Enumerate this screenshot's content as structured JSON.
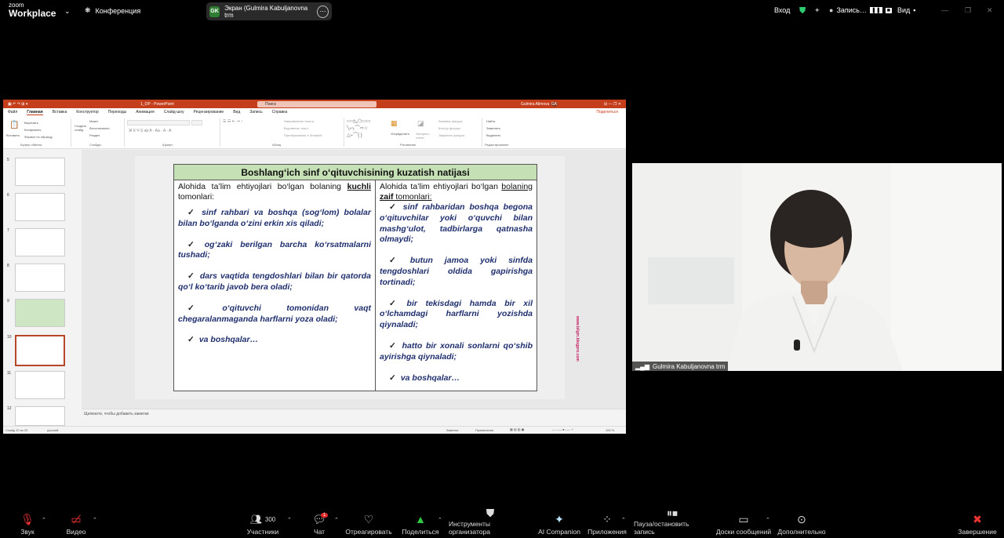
{
  "zoom": {
    "brand_top": "zoom",
    "brand_bottom": "Workplace",
    "conference": "Конференция",
    "share_label": "Экран (Gulmira Kabuljanovna trm",
    "share_initials": "GK",
    "login": "Вход",
    "record": "Запись…",
    "view": "Вид"
  },
  "ppt": {
    "filename": "1_OP - PowerPoint",
    "search": "Поиск",
    "user": "Gulmira Alimova",
    "user_initials": "GA",
    "tabs": [
      "Файл",
      "Главная",
      "Вставка",
      "Конструктор",
      "Переходы",
      "Анимация",
      "Слайд-шоу",
      "Рецензирование",
      "Вид",
      "Запись",
      "Справка"
    ],
    "share": "Поделиться",
    "groups": {
      "clipboard": "Буфер обмена",
      "slides": "Слайды",
      "font": "Шрифт",
      "paragraph": "Абзац",
      "drawing": "Рисование",
      "editing": "Редактирование"
    },
    "ribbon": {
      "paste": "Вставить",
      "cut": "Вырезать",
      "copy": "Копировать",
      "format": "Формат по образцу",
      "new_slide": "Создать слайд",
      "layout": "Макет",
      "reset": "Восстановить",
      "section": "Раздел",
      "text_dir": "Направление текста",
      "align_text": "Выровнять текст",
      "smartart": "Преобразовать в SmartArt",
      "arrange": "Упорядочить",
      "styles": "Экспресс-стили",
      "fill": "Заливка фигуры",
      "outline": "Контур фигуры",
      "effects": "Эффекты фигуры",
      "find": "Найти",
      "replace": "Заменить",
      "select": "Выделить"
    },
    "slide_numbers": [
      "5",
      "6",
      "7",
      "8",
      "9",
      "10",
      "11",
      "12"
    ],
    "notes": "Щелкните, чтобы добавить заметки",
    "status": {
      "slide": "Слайд 10 из 23",
      "lang": "русский",
      "notes": "Заметки",
      "comments": "Примечания",
      "zoom": "100 %"
    }
  },
  "slide": {
    "title": "Boshlang‘ich sinf o‘qituvchisining kuzatish natijasi",
    "left_head_a": "Alohida ta’lim ehtiyojlari bo‘lgan bolaning ",
    "left_head_b": "kuchli",
    "left_head_c": " tomonlari:",
    "left_items": [
      "sinf rahbari va boshqa (sog‘lom) bolalar bilan bo‘lganda o‘zini erkin xis qiladi;",
      "og‘zaki berilgan barcha ko‘rsatmalarni tushadi;",
      "dars vaqtida tengdoshlari bilan bir qatorda qo‘l ko‘tarib javob bera oladi;",
      "o‘qituvchi tomonidan vaqt chegaralanmaganda harflarni yoza oladi;",
      "va boshqalar…"
    ],
    "right_head_a": "Alohida ta’lim ehtiyojlari bo‘lgan ",
    "right_head_b": "bolaning ",
    "right_head_c": "zaif",
    "right_head_d": " tomonlari:",
    "right_items": [
      "sinf rahbaridan boshqa begona o‘qituvchilar yoki o‘quvchi bilan mashg‘ulot, tadbirlarga qatnasha olmaydi;",
      "butun jamoa yoki sinfda tengdoshlari oldida gapirishga tortinadi;",
      "bir tekisdagi hamda bir xil o‘lchamdagi harflarni yozishda qiynaladi;",
      "hatto bir xonali sonlarni qo‘shib ayirishga qiynaladi;",
      "va boshqalar…"
    ],
    "site": "www.bilgin.blogpro.com"
  },
  "video": {
    "name": "Gulmira Kabuljanovna trm"
  },
  "bottom": {
    "audio": "Звук",
    "video": "Видео",
    "participants": "Участники",
    "participants_count": "300",
    "chat": "Чат",
    "chat_badge": "1",
    "react": "Отреагировать",
    "share": "Поделиться",
    "host": "Инструменты организатора",
    "ai": "AI Companion",
    "apps": "Приложения",
    "pause": "Пауза/остановить запись",
    "whiteboards": "Доски сообщений",
    "more": "Дополнительно",
    "end": "Завершение"
  }
}
